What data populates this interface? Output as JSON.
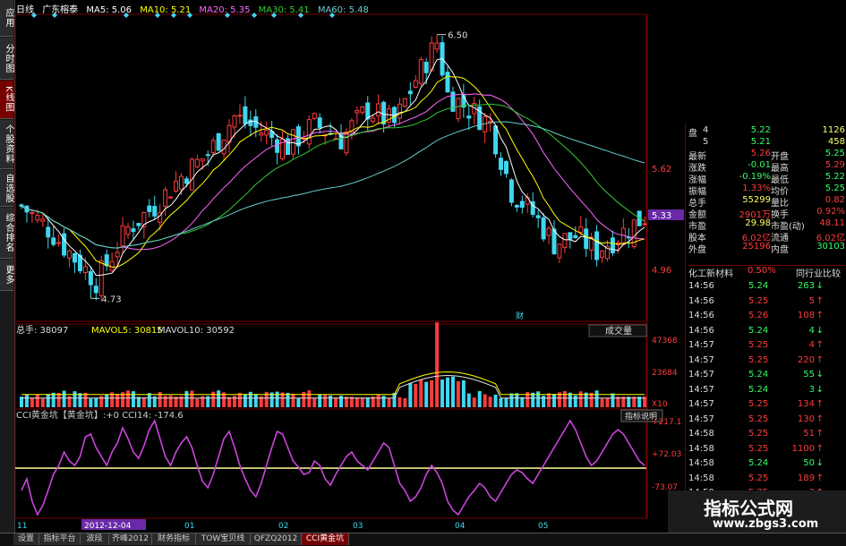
{
  "left_tabs": [
    {
      "label": "应用",
      "active": false
    },
    {
      "label": "分时图",
      "active": false
    },
    {
      "label": "K线图",
      "active": true
    },
    {
      "label": "个股资料",
      "active": false
    },
    {
      "label": "自选股",
      "active": false
    },
    {
      "label": "综合排名",
      "active": false
    },
    {
      "label": "更多",
      "active": false
    }
  ],
  "header": {
    "period": "日线",
    "stock": "广东榕泰",
    "ma5": "MA5: 5.06",
    "ma10": "MA10: 5.21",
    "ma20": "MA20: 5.35",
    "ma30": "MA30: 5.41",
    "ma60": "MA60: 5.48"
  },
  "price_panel": {
    "high_label": "6.50",
    "low_label": "4.73",
    "axis": [
      "5.62",
      "5.33",
      "4.96"
    ],
    "current_price": "5.33",
    "cai_marker": "财"
  },
  "volume_panel": {
    "label_total": "总手: 38097",
    "mavol5": "MAVOL5: 30815",
    "mavol10": "MAVOL10: 30592",
    "dropdown": "成交量",
    "axis": [
      "47368",
      "23684",
      "X10"
    ]
  },
  "cci_panel": {
    "title": "CCI黄金坑【黄金坑】:+0  CCI14: -174.6",
    "button": "指标说明",
    "axis": [
      "+217.1",
      "+72.03",
      "-73.07"
    ]
  },
  "date_axis": {
    "selected_date": "2012-12-04",
    "labels": [
      "11",
      "01",
      "02",
      "03",
      "04",
      "05"
    ]
  },
  "quote": {
    "rows": [
      {
        "l": "盘",
        "n": "4",
        "v": "5.22",
        "r": "",
        "rv": "1126"
      },
      {
        "l": "",
        "n": "5",
        "v": "5.21",
        "r": "",
        "rv": "458"
      },
      {
        "l": "最新",
        "n": "",
        "v": "5.26",
        "r": "开盘",
        "rv": "5.25"
      },
      {
        "l": "涨跌",
        "n": "",
        "v": "-0.01",
        "r": "最高",
        "rv": "5.29"
      },
      {
        "l": "涨幅",
        "n": "",
        "v": "-0.19%",
        "r": "最低",
        "rv": "5.22"
      },
      {
        "l": "振幅",
        "n": "",
        "v": "1.33%",
        "r": "均价",
        "rv": "5.25"
      },
      {
        "l": "总手",
        "n": "",
        "v": "55299",
        "r": "量比",
        "rv": "0.82"
      },
      {
        "l": "金额",
        "n": "",
        "v": "2901万",
        "r": "换手",
        "rv": "0.92%"
      },
      {
        "l": "市盈",
        "n": "",
        "v": "29.98",
        "r": "市盈(动)",
        "rv": "48.11"
      },
      {
        "l": "股本",
        "n": "",
        "v": "6.02亿",
        "r": "流通",
        "rv": "6.02亿"
      },
      {
        "l": "外盘",
        "n": "",
        "v": "25196",
        "r": "内盘",
        "rv": "30103"
      }
    ],
    "industry": "化工新材料",
    "industry_pct": "0.50%",
    "compare": "同行业比较"
  },
  "ticks": [
    {
      "t": "14:56",
      "p": "5.24",
      "v": "263",
      "dir": "down"
    },
    {
      "t": "14:56",
      "p": "5.25",
      "v": "5",
      "dir": "up"
    },
    {
      "t": "14:56",
      "p": "5.26",
      "v": "108",
      "dir": "up"
    },
    {
      "t": "14:56",
      "p": "5.24",
      "v": "4",
      "dir": "down"
    },
    {
      "t": "14:57",
      "p": "5.25",
      "v": "4",
      "dir": "up"
    },
    {
      "t": "14:57",
      "p": "5.25",
      "v": "220",
      "dir": "up"
    },
    {
      "t": "14:57",
      "p": "5.24",
      "v": "55",
      "dir": "down"
    },
    {
      "t": "14:57",
      "p": "5.24",
      "v": "3",
      "dir": "down"
    },
    {
      "t": "14:57",
      "p": "5.25",
      "v": "134",
      "dir": "up"
    },
    {
      "t": "14:57",
      "p": "5.25",
      "v": "130",
      "dir": "up"
    },
    {
      "t": "14:58",
      "p": "5.25",
      "v": "51",
      "dir": "up"
    },
    {
      "t": "14:58",
      "p": "5.25",
      "v": "1100",
      "dir": "up"
    },
    {
      "t": "14:58",
      "p": "5.24",
      "v": "50",
      "dir": "down"
    },
    {
      "t": "14:58",
      "p": "5.25",
      "v": "189",
      "dir": "up"
    },
    {
      "t": "14:59",
      "p": "5.25",
      "v": "3",
      "dir": "up"
    },
    {
      "t": "14:59",
      "p": "5.25",
      "v": "165",
      "dir": "up"
    }
  ],
  "bottom_tabs": [
    {
      "label": "设置",
      "active": false
    },
    {
      "label": "指标平台",
      "active": false
    },
    {
      "label": "波段",
      "active": false
    },
    {
      "label": "齐峰2012",
      "active": false
    },
    {
      "label": "财务指标",
      "active": false
    },
    {
      "label": "TOW宝贝线",
      "active": false
    },
    {
      "label": "QFZQ2012",
      "active": false
    },
    {
      "label": "CCI黄金坑",
      "active": true
    }
  ],
  "watermark": {
    "title": "指标公式网",
    "url": "www.zbgs3.com"
  },
  "colors": {
    "up": "#ff3b3b",
    "down": "#3fd7f0",
    "ma5": "#ffffff",
    "ma10": "#ffff00",
    "ma20": "#ff66ff",
    "ma30": "#33cc33",
    "ma60": "#66cccc",
    "cci": "#cc44dd",
    "zero": "#ffff99"
  }
}
